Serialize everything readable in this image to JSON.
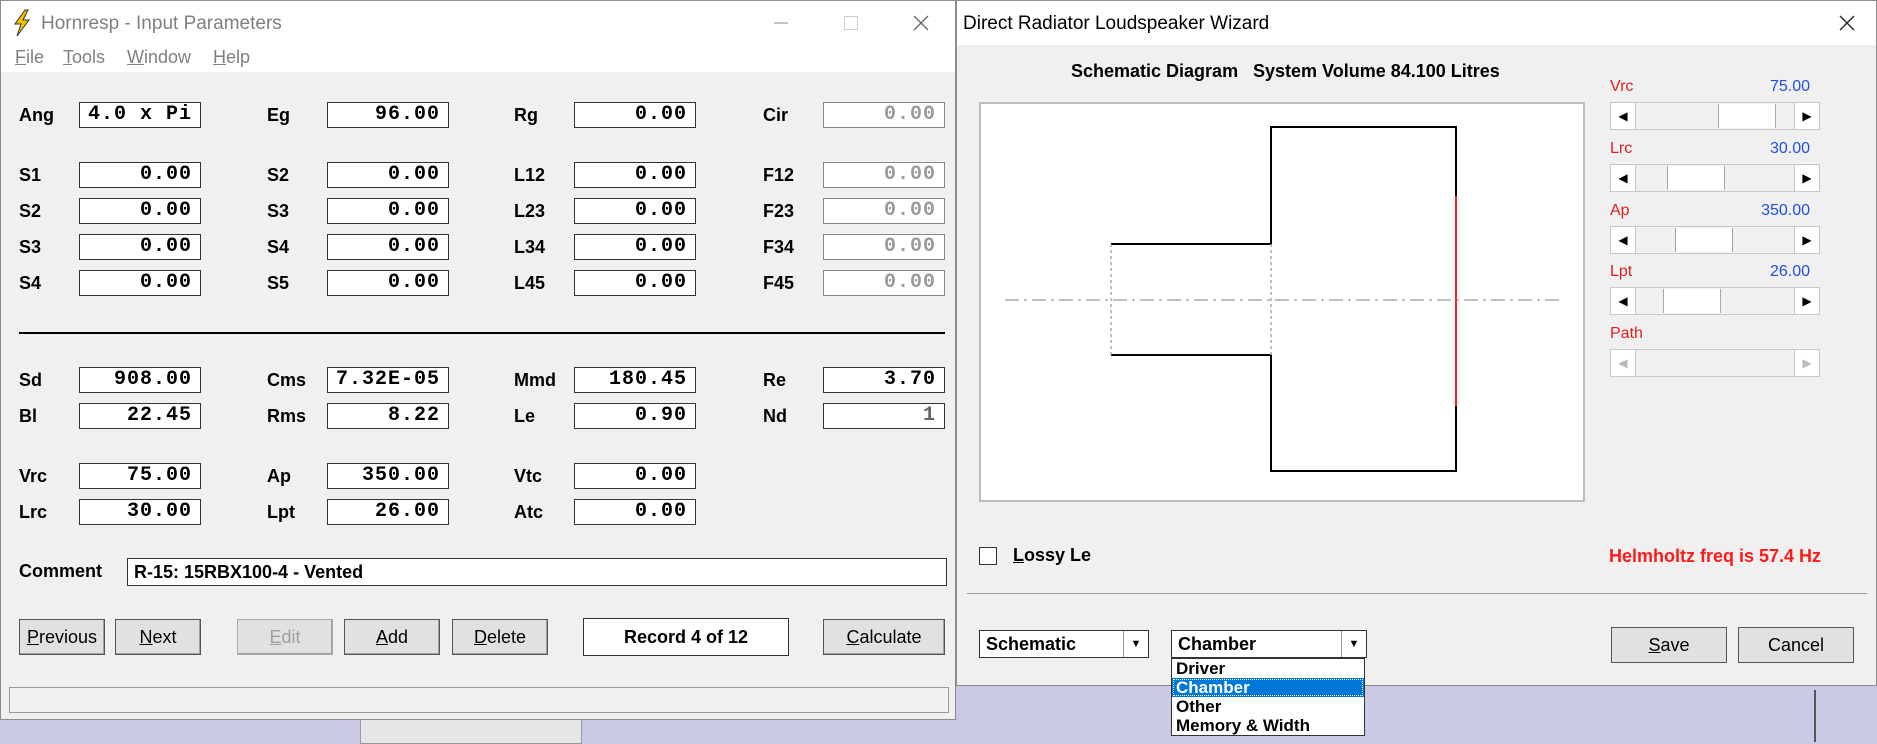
{
  "left_window": {
    "title": "Hornresp - Input Parameters",
    "menu": [
      {
        "first": "F",
        "rest": "ile"
      },
      {
        "first": "T",
        "rest": "ools"
      },
      {
        "first": "W",
        "rest": "indow"
      },
      {
        "first": "H",
        "rest": "elp"
      }
    ],
    "row0": {
      "Ang": {
        "label": "Ang",
        "value": "4.0 x Pi"
      },
      "Eg": {
        "label": "Eg",
        "value": "96.00"
      },
      "Rg": {
        "label": "Rg",
        "value": "0.00"
      },
      "Cir": {
        "label": "Cir",
        "value": "0.00"
      }
    },
    "segments": [
      {
        "a": "S1",
        "av": "0.00",
        "b": "S2",
        "bv": "0.00",
        "c": "L12",
        "cv": "0.00",
        "d": "F12",
        "dv": "0.00"
      },
      {
        "a": "S2",
        "av": "0.00",
        "b": "S3",
        "bv": "0.00",
        "c": "L23",
        "cv": "0.00",
        "d": "F23",
        "dv": "0.00"
      },
      {
        "a": "S3",
        "av": "0.00",
        "b": "S4",
        "bv": "0.00",
        "c": "L34",
        "cv": "0.00",
        "d": "F34",
        "dv": "0.00"
      },
      {
        "a": "S4",
        "av": "0.00",
        "b": "S5",
        "bv": "0.00",
        "c": "L45",
        "cv": "0.00",
        "d": "F45",
        "dv": "0.00"
      }
    ],
    "driver": [
      {
        "a": "Sd",
        "av": "908.00",
        "b": "Cms",
        "bv": "7.32E-05",
        "c": "Mmd",
        "cv": "180.45",
        "d": "Re",
        "dv": "3.70"
      },
      {
        "a": "Bl",
        "av": "22.45",
        "b": "Rms",
        "bv": "8.22",
        "c": "Le",
        "cv": "0.90",
        "d": "Nd",
        "dv": "1"
      }
    ],
    "chamber": [
      {
        "a": "Vrc",
        "av": "75.00",
        "b": "Ap",
        "bv": "350.00",
        "c": "Vtc",
        "cv": "0.00"
      },
      {
        "a": "Lrc",
        "av": "30.00",
        "b": "Lpt",
        "bv": "26.00",
        "c": "Atc",
        "cv": "0.00"
      }
    ],
    "comment_label": "Comment",
    "comment_value": "R-15: 15RBX100-4 - Vented",
    "buttons": {
      "previous": {
        "first": "P",
        "rest": "revious"
      },
      "next": {
        "first": "N",
        "rest": "ext"
      },
      "edit": {
        "first": "E",
        "rest": "dit"
      },
      "add": {
        "first": "A",
        "rest": "dd"
      },
      "delete": {
        "first": "D",
        "rest": "elete"
      },
      "calculate": {
        "first": "C",
        "rest": "alculate"
      }
    },
    "record": "Record 4 of 12"
  },
  "right_window": {
    "title": "Direct Radiator Loudspeaker Wizard",
    "schematic_title": "Schematic Diagram",
    "system_volume": "System Volume 84.100 Litres",
    "sliders": [
      {
        "label": "Vrc",
        "value": "75.00",
        "position": 0.78
      },
      {
        "label": "Lrc",
        "value": "30.00",
        "position": 0.3
      },
      {
        "label": "Ap",
        "value": "350.00",
        "position": 0.38
      },
      {
        "label": "Lpt",
        "value": "26.00",
        "position": 0.26
      },
      {
        "label": "Path",
        "value": "",
        "position": 0
      }
    ],
    "lossy_le": {
      "first": "L",
      "rest": "ossy Le",
      "checked": false
    },
    "helmholtz": "Helmholtz freq is 57.4 Hz",
    "view_select": "Schematic",
    "section_select": "Chamber",
    "section_options": [
      "Driver",
      "Chamber",
      "Other",
      "Memory & Width"
    ],
    "selected_option": "Chamber",
    "save": {
      "first": "S",
      "rest": "ave"
    },
    "cancel": "Cancel"
  },
  "colors": {
    "slider_label": "#e02020",
    "slider_value": "#2050e0",
    "helmholtz": "#ff1a1a",
    "selection": "#0078d7"
  }
}
